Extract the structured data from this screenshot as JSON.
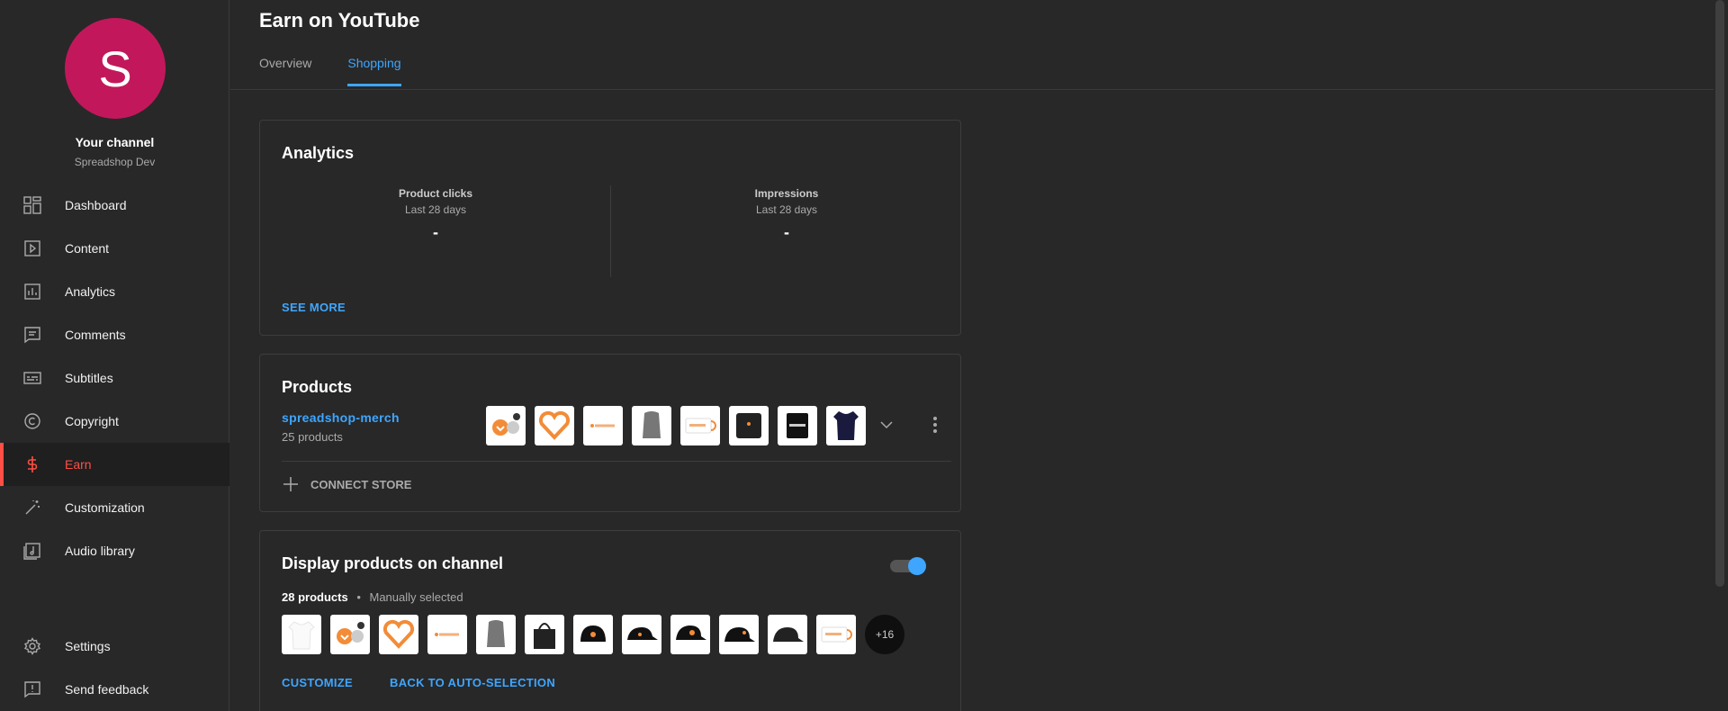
{
  "channel": {
    "avatar_letter": "S",
    "title": "Your channel",
    "name": "Spreadshop Dev"
  },
  "nav": [
    {
      "label": "Dashboard",
      "icon": "dashboard-icon"
    },
    {
      "label": "Content",
      "icon": "content-icon"
    },
    {
      "label": "Analytics",
      "icon": "analytics-icon"
    },
    {
      "label": "Comments",
      "icon": "comments-icon"
    },
    {
      "label": "Subtitles",
      "icon": "subtitles-icon"
    },
    {
      "label": "Copyright",
      "icon": "copyright-icon"
    },
    {
      "label": "Earn",
      "icon": "dollar-icon",
      "active": true
    },
    {
      "label": "Customization",
      "icon": "magic-wand-icon"
    },
    {
      "label": "Audio library",
      "icon": "audio-library-icon"
    }
  ],
  "nav_bottom": [
    {
      "label": "Settings",
      "icon": "gear-icon"
    },
    {
      "label": "Send feedback",
      "icon": "feedback-icon"
    }
  ],
  "page": {
    "title": "Earn on YouTube"
  },
  "tabs": [
    {
      "label": "Overview"
    },
    {
      "label": "Shopping",
      "active": true
    }
  ],
  "analytics": {
    "title": "Analytics",
    "metrics": [
      {
        "title": "Product clicks",
        "period": "Last 28 days",
        "value": "-"
      },
      {
        "title": "Impressions",
        "period": "Last 28 days",
        "value": "-"
      }
    ],
    "see_more": "SEE MORE"
  },
  "products": {
    "title": "Products",
    "store_name": "spreadshop-merch",
    "store_count": "25 products",
    "connect_store": "CONNECT STORE"
  },
  "display": {
    "title": "Display products on channel",
    "toggle_on": true,
    "count": "28 products",
    "separator": "•",
    "selection": "Manually selected",
    "more_count": "+16",
    "customize": "CUSTOMIZE",
    "back_auto": "BACK TO AUTO-SELECTION"
  },
  "colors": {
    "accent": "#3ea6ff",
    "active_red": "#ff4e45",
    "avatar": "#c2185b",
    "brand_orange": "#f28c38"
  }
}
